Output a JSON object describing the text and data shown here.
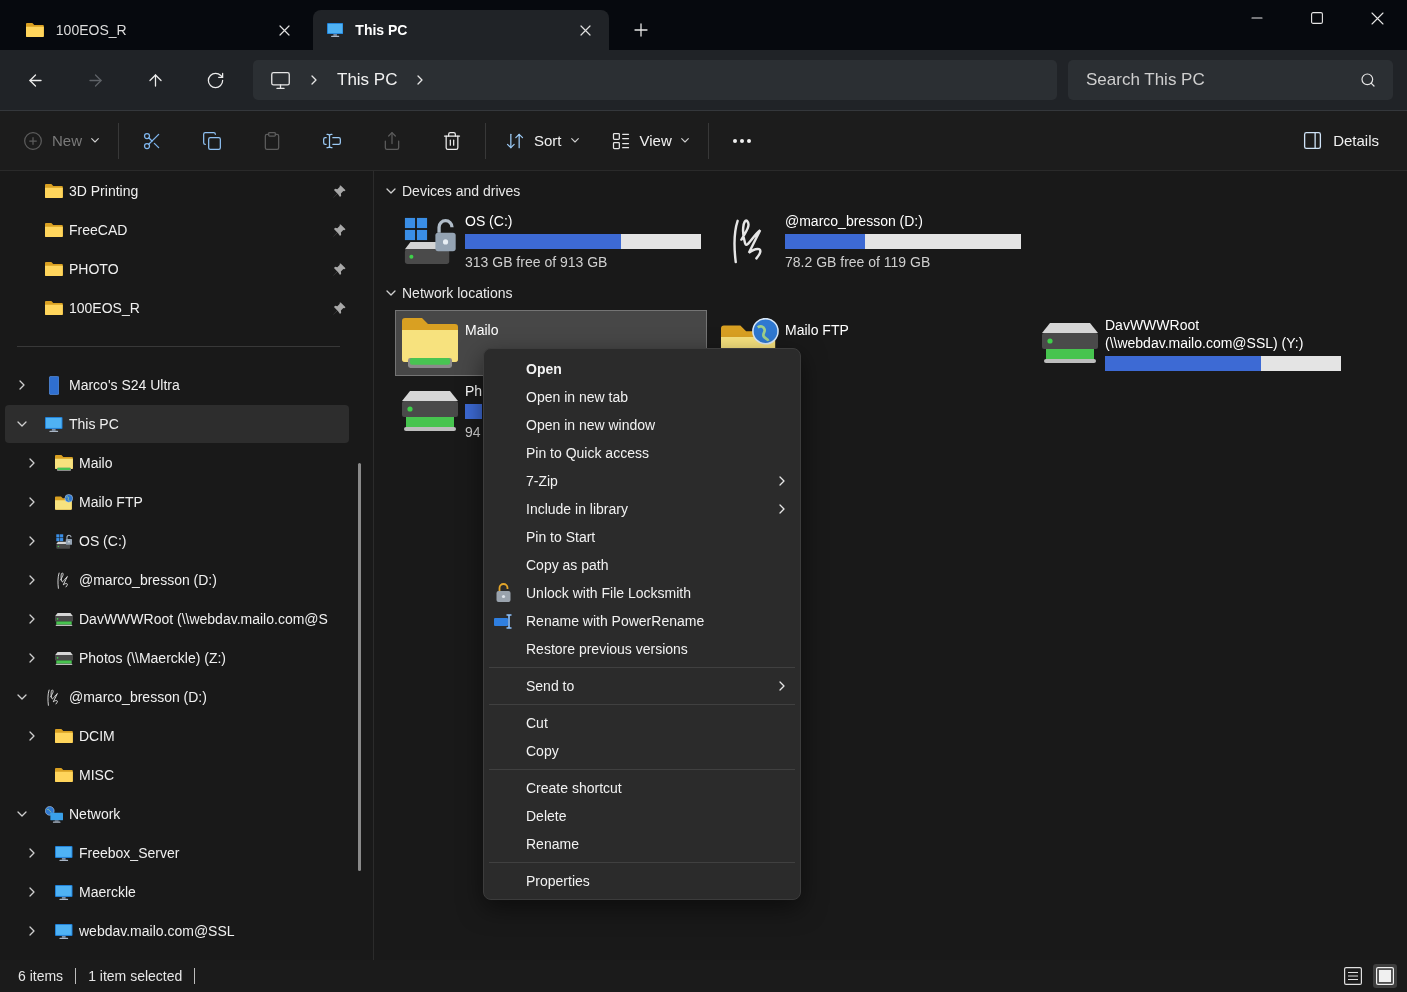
{
  "tabs": [
    {
      "kind": "folder",
      "label": "100EOS_R",
      "selected": false
    },
    {
      "kind": "computer",
      "label": "This PC",
      "selected": true
    }
  ],
  "nav": {
    "buttons": [
      {
        "kind": "back",
        "disabled": false
      },
      {
        "kind": "forward",
        "disabled": true
      },
      {
        "kind": "up",
        "disabled": false
      },
      {
        "kind": "refresh",
        "disabled": false
      }
    ]
  },
  "address": {
    "segments": [
      "This PC"
    ]
  },
  "search": {
    "placeholder": "Search This PC"
  },
  "toolbar": {
    "groups": [
      [
        {
          "kind": "new",
          "label": "New",
          "menu": true,
          "disabled": true
        }
      ],
      [
        {
          "kind": "cut",
          "disabled": false
        },
        {
          "kind": "copy",
          "disabled": false
        },
        {
          "kind": "paste",
          "disabled": true
        },
        {
          "kind": "rename",
          "disabled": false
        },
        {
          "kind": "share",
          "disabled": true
        },
        {
          "kind": "delete",
          "disabled": false
        }
      ],
      [
        {
          "kind": "sort",
          "label": "Sort",
          "menu": true,
          "disabled": false
        },
        {
          "kind": "view",
          "label": "View",
          "menu": true,
          "disabled": false
        }
      ],
      [
        {
          "kind": "more",
          "disabled": false
        }
      ]
    ],
    "details": {
      "label": "Details"
    }
  },
  "sidebar": {
    "quick_access": [
      {
        "kind": "folder",
        "label": "3D Printing",
        "pinned": true,
        "selected": false
      },
      {
        "kind": "folder",
        "label": "FreeCAD",
        "pinned": true,
        "selected": false
      },
      {
        "kind": "folder",
        "label": "PHOTO",
        "pinned": true,
        "selected": false
      },
      {
        "kind": "folder",
        "label": "100EOS_R",
        "pinned": true,
        "selected": false
      }
    ],
    "tree": [
      {
        "kind": "phone",
        "label": "Marco's S24 Ultra",
        "expanded": false,
        "selected": false
      },
      {
        "kind": "computer",
        "label": "This PC",
        "expanded": true,
        "selected": true,
        "children": [
          {
            "kind": "network-folder",
            "label": "Mailo",
            "expanded": false,
            "selected": false
          },
          {
            "kind": "ftp",
            "label": "Mailo FTP",
            "expanded": false,
            "selected": false
          },
          {
            "kind": "system-drive",
            "label": "OS (C:)",
            "expanded": false,
            "selected": false
          },
          {
            "kind": "signature-drive",
            "label": "@marco_bresson (D:)",
            "expanded": false,
            "selected": false
          },
          {
            "kind": "network-drive",
            "label": "DavWWWRoot (\\\\webdav.mailo.com@S",
            "expanded": false,
            "selected": false
          },
          {
            "kind": "network-drive",
            "label": "Photos (\\\\Maerckle) (Z:)",
            "expanded": false,
            "selected": false
          }
        ]
      },
      {
        "kind": "signature-drive",
        "label": "@marco_bresson (D:)",
        "expanded": true,
        "selected": false,
        "children": [
          {
            "kind": "folder",
            "label": "DCIM",
            "expanded": false,
            "selected": false
          },
          {
            "kind": "folder",
            "label": "MISC",
            "selected": false
          }
        ]
      },
      {
        "kind": "network",
        "label": "Network",
        "expanded": true,
        "selected": false,
        "children": [
          {
            "kind": "computer",
            "label": "Freebox_Server",
            "expanded": false,
            "selected": false
          },
          {
            "kind": "computer",
            "label": "Maerckle",
            "expanded": false,
            "selected": false
          },
          {
            "kind": "computer",
            "label": "webdav.mailo.com@SSL",
            "expanded": false,
            "selected": false
          }
        ]
      }
    ]
  },
  "sections": [
    {
      "title": "Devices and drives",
      "expanded": true,
      "items": [
        {
          "kind": "system-drive",
          "name": "OS (C:)",
          "level": 0.66,
          "detail": "313 GB free of 913 GB",
          "selected": false
        },
        {
          "kind": "signature-drive",
          "name": "@marco_bresson (D:)",
          "level": 0.34,
          "detail": "78.2 GB free of 119 GB",
          "selected": false
        }
      ]
    },
    {
      "title": "Network locations",
      "expanded": true,
      "items": [
        {
          "kind": "network-folder",
          "name": "Mailo",
          "selected": true
        },
        {
          "kind": "ftp",
          "name": "Mailo FTP",
          "selected": false
        },
        {
          "kind": "network-drive",
          "name": "DavWWWRoot (\\\\webdav.mailo.com@SSL) (Y:)",
          "level": 0.66,
          "selected": false
        },
        {
          "kind": "network-drive",
          "name": "Ph",
          "covered_bar": true,
          "detail": "94",
          "selected": false
        }
      ]
    }
  ],
  "context_menu": {
    "groups": [
      [
        {
          "kind": "plain",
          "label": "Open",
          "default": true,
          "submenu": false
        },
        {
          "kind": "plain",
          "label": "Open in new tab",
          "default": false,
          "submenu": false
        },
        {
          "kind": "plain",
          "label": "Open in new window",
          "default": false,
          "submenu": false
        },
        {
          "kind": "plain",
          "label": "Pin to Quick access",
          "default": false,
          "submenu": false
        },
        {
          "kind": "plain",
          "label": "7-Zip",
          "default": false,
          "submenu": true
        },
        {
          "kind": "plain",
          "label": "Include in library",
          "default": false,
          "submenu": true
        },
        {
          "kind": "plain",
          "label": "Pin to Start",
          "default": false,
          "submenu": false
        },
        {
          "kind": "plain",
          "label": "Copy as path",
          "default": false,
          "submenu": false
        },
        {
          "kind": "lock-app",
          "label": "Unlock with File Locksmith",
          "default": false,
          "submenu": false
        },
        {
          "kind": "rename-app",
          "label": "Rename with PowerRename",
          "default": false,
          "submenu": false
        },
        {
          "kind": "plain",
          "label": "Restore previous versions",
          "default": false,
          "submenu": false
        }
      ],
      [
        {
          "kind": "plain",
          "label": "Send to",
          "default": false,
          "submenu": true
        }
      ],
      [
        {
          "kind": "plain",
          "label": "Cut",
          "default": false,
          "submenu": false
        },
        {
          "kind": "plain",
          "label": "Copy",
          "default": false,
          "submenu": false
        }
      ],
      [
        {
          "kind": "plain",
          "label": "Create shortcut",
          "default": false,
          "submenu": false
        },
        {
          "kind": "plain",
          "label": "Delete",
          "default": false,
          "submenu": false
        },
        {
          "kind": "plain",
          "label": "Rename",
          "default": false,
          "submenu": false
        }
      ],
      [
        {
          "kind": "plain",
          "label": "Properties",
          "default": false,
          "submenu": false
        }
      ]
    ]
  },
  "status_bar": {
    "items": [
      "6 items",
      "1 item selected"
    ],
    "views": [
      {
        "kind": "details",
        "selected": false
      },
      {
        "kind": "tiles",
        "selected": true
      }
    ]
  }
}
